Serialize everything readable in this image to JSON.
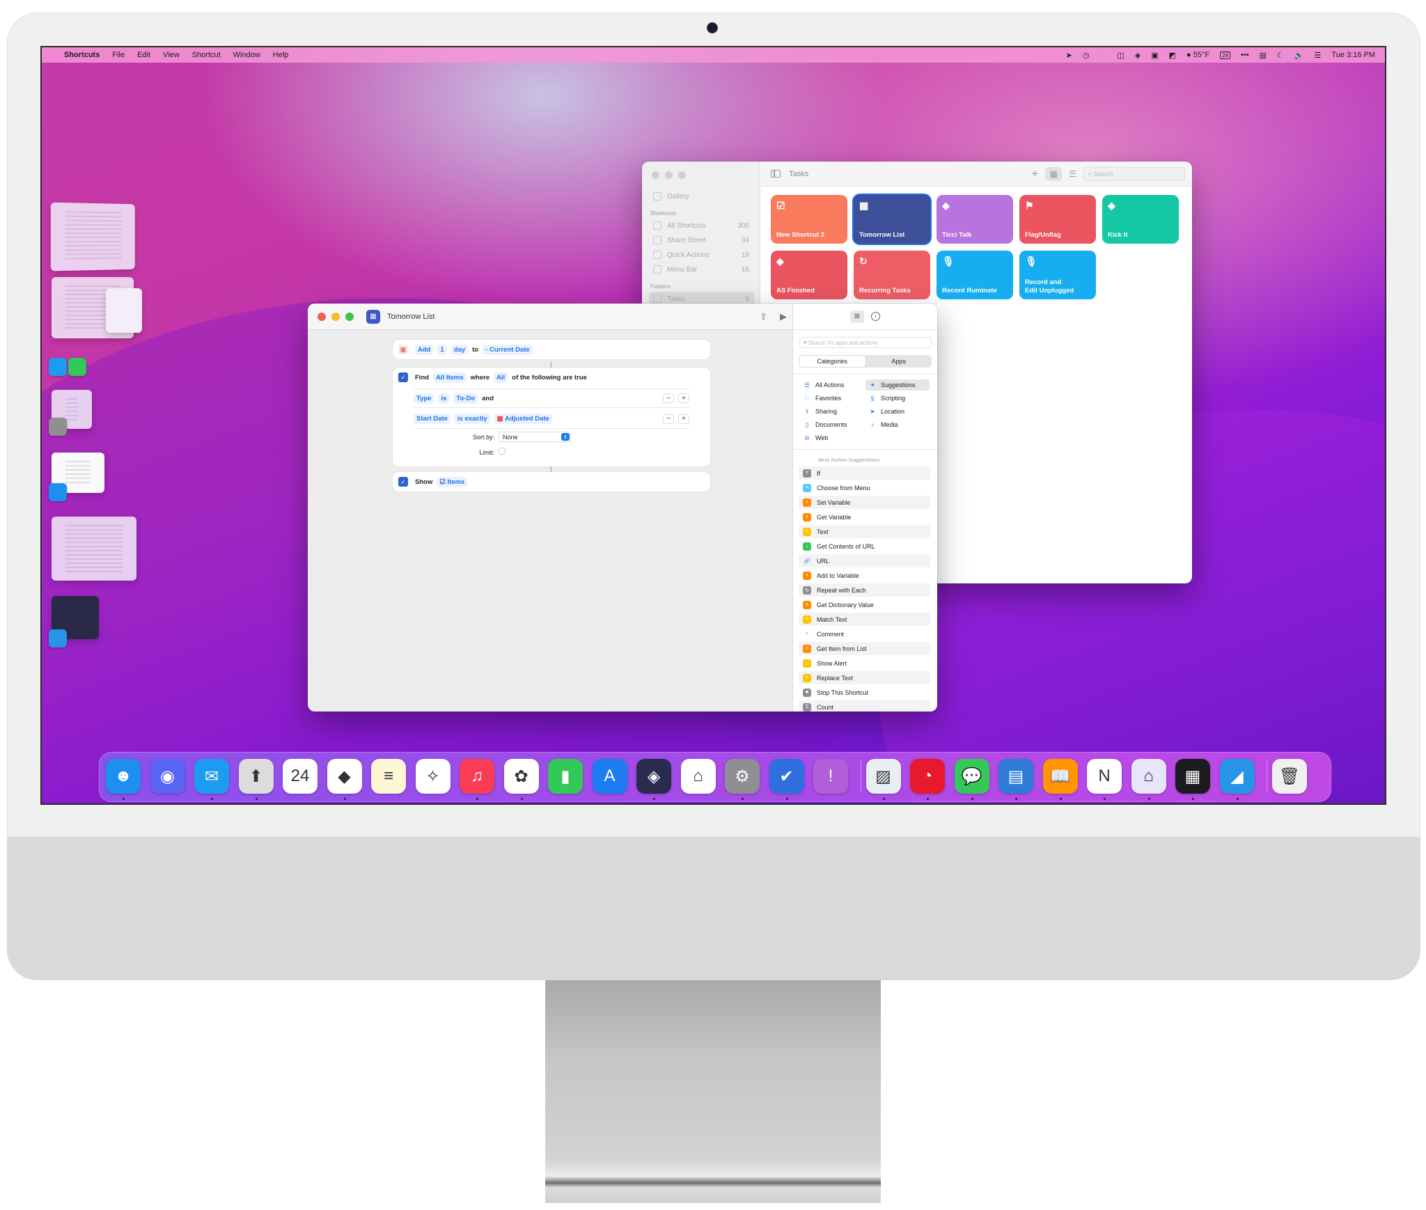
{
  "menubar": {
    "apple_icon": "apple-logo-icon",
    "app_name": "Shortcuts",
    "menus": [
      "File",
      "Edit",
      "View",
      "Shortcut",
      "Window",
      "Help"
    ],
    "status_icons": [
      "location-arrow-icon",
      "time-machine-icon",
      "focus-moon-icon",
      "split-view-icon",
      "layers-icon",
      "bookmark-icon",
      "cursor-pointer-icon",
      "weather-icon",
      "calendar-icon",
      "more-icon",
      "menu-app-icon",
      "moon-icon",
      "volume-icon",
      "control-center-icon"
    ],
    "weather": "55°F",
    "calendar_day": "24",
    "more": "•••",
    "clock": "Tue 3:16 PM"
  },
  "tasks_window": {
    "sidebar": {
      "gallery": "Gallery",
      "shortcuts_header": "Shortcuts",
      "items": [
        {
          "label": "All Shortcuts",
          "count": "300"
        },
        {
          "label": "Share Sheet",
          "count": "34"
        },
        {
          "label": "Quick Actions",
          "count": "18"
        },
        {
          "label": "Menu Bar",
          "count": "16"
        }
      ],
      "folders_header": "Folders",
      "folders": [
        {
          "label": "Tasks",
          "count": "9"
        }
      ]
    },
    "title": "Tasks",
    "add_label": "+",
    "search_placeholder": "Search",
    "tiles": [
      {
        "label": "New Shortcut 2",
        "icon": "☑",
        "color": "#f97a5c"
      },
      {
        "label": "Tomorrow List",
        "icon": "▦",
        "color": "#3e4f9a"
      },
      {
        "label": "Ticci Talk",
        "icon": "◈",
        "color": "#b873de"
      },
      {
        "label": "Flag/Unflag",
        "icon": "⚑",
        "color": "#ea5560"
      },
      {
        "label": "Kick It",
        "icon": "◈",
        "color": "#15c8a5"
      },
      {
        "label": "AS Finished",
        "icon": "◈",
        "color": "#ea5560"
      },
      {
        "label": "Recurring Tasks",
        "icon": "↻",
        "color": "#ef5d66"
      },
      {
        "label": "Record Ruminate",
        "icon": "🎙",
        "color": "#16aef0"
      },
      {
        "label": "Record  and\nEdit Unplugged",
        "icon": "🎙",
        "color": "#16aef0"
      }
    ]
  },
  "editor": {
    "title": "Tomorrow List",
    "actions": {
      "add": {
        "verb": "Add",
        "amount": "1",
        "unit": "day",
        "to": "to",
        "target": "Current Date"
      },
      "find": {
        "verb": "Find",
        "what": "All Items",
        "where": "where",
        "quantifier": "All",
        "suffix": "of the following are true",
        "conditions": [
          {
            "field": "Type",
            "op": "is",
            "value": "To-Do",
            "join": "and"
          },
          {
            "field": "Start Date",
            "op": "is exactly",
            "value": "Adjusted Date",
            "join": ""
          }
        ],
        "sort_label": "Sort by:",
        "sort_value": "None",
        "limit_label": "Limit:",
        "limit_checked": false
      },
      "show": {
        "verb": "Show",
        "target": "Items"
      }
    },
    "minus": "−",
    "plus": "+",
    "panel": {
      "search_placeholder": "Search for apps and actions",
      "segments": [
        "Categories",
        "Apps"
      ],
      "selected_segment": "Categories",
      "categories": [
        {
          "label": "All Actions",
          "icon": "☰"
        },
        {
          "label": "Favorites",
          "icon": "♡"
        },
        {
          "label": "Sharing",
          "icon": "⇪"
        },
        {
          "label": "Documents",
          "icon": "▯"
        },
        {
          "label": "Web",
          "icon": "⊘"
        },
        {
          "label": "Suggestions",
          "icon": "✦"
        },
        {
          "label": "Scripting",
          "icon": "§"
        },
        {
          "label": "Location",
          "icon": "➤"
        },
        {
          "label": "Media",
          "icon": "♪"
        }
      ],
      "suggestions_header": "Next Action Suggestions",
      "suggestions": [
        {
          "label": "If",
          "color": "#8e8e93",
          "glyph": "Y"
        },
        {
          "label": "Choose from Menu",
          "color": "#5ac8fa",
          "glyph": "≡"
        },
        {
          "label": "Set Variable",
          "color": "#ff8a00",
          "glyph": "x"
        },
        {
          "label": "Get Variable",
          "color": "#ff8a00",
          "glyph": "x"
        },
        {
          "label": "Text",
          "color": "#ffc400",
          "glyph": "≡"
        },
        {
          "label": "Get Contents of URL",
          "color": "#34c759",
          "glyph": "↓"
        },
        {
          "label": "URL",
          "color": "#e8effb",
          "glyph": "🔗"
        },
        {
          "label": "Add to Variable",
          "color": "#ff8a00",
          "glyph": "x"
        },
        {
          "label": "Repeat with Each",
          "color": "#8e8e93",
          "glyph": "↻"
        },
        {
          "label": "Get Dictionary Value",
          "color": "#ff8a00",
          "glyph": "o"
        },
        {
          "label": "Match Text",
          "color": "#ffc400",
          "glyph": "≡"
        },
        {
          "label": "Comment",
          "color": "#ffffff",
          "glyph": "≡"
        },
        {
          "label": "Get Item from List",
          "color": "#ff8a00",
          "glyph": "o"
        },
        {
          "label": "Show Alert",
          "color": "#ffc400",
          "glyph": "▭"
        },
        {
          "label": "Replace Text",
          "color": "#ffc400",
          "glyph": "≡"
        },
        {
          "label": "Stop This Shortcut",
          "color": "#8e8e93",
          "glyph": "■"
        },
        {
          "label": "Count",
          "color": "#8e8e93",
          "glyph": "Σ"
        }
      ]
    }
  },
  "dock": {
    "apps": [
      {
        "name": "Finder",
        "glyph": "☻",
        "color": "#1e8ef0",
        "running": true
      },
      {
        "name": "Discord",
        "glyph": "◉",
        "color": "#5865f2",
        "running": false
      },
      {
        "name": "Mail",
        "glyph": "✉",
        "color": "#1c9bf0",
        "running": true
      },
      {
        "name": "Archive Utility",
        "glyph": "⬆",
        "color": "#dcdcdc",
        "running": true
      },
      {
        "name": "Calendar",
        "glyph": "24",
        "color": "#ffffff",
        "running": false
      },
      {
        "name": "Obsidian",
        "glyph": "◆",
        "color": "#ffffff",
        "running": true
      },
      {
        "name": "Notes",
        "glyph": "≡",
        "color": "#fff6d6",
        "running": false
      },
      {
        "name": "Safari",
        "glyph": "✧",
        "color": "#ffffff",
        "running": false
      },
      {
        "name": "Music",
        "glyph": "♫",
        "color": "#fa3d55",
        "running": true
      },
      {
        "name": "Photos",
        "glyph": "✿",
        "color": "#ffffff",
        "running": true
      },
      {
        "name": "Numbers",
        "glyph": "▮",
        "color": "#34c759",
        "running": false
      },
      {
        "name": "App Store",
        "glyph": "A",
        "color": "#1e7cf2",
        "running": false
      },
      {
        "name": "Shortcuts",
        "glyph": "◈",
        "color": "#2b2b4f",
        "running": true
      },
      {
        "name": "Home",
        "glyph": "⌂",
        "color": "#ffffff",
        "running": false
      },
      {
        "name": "System Preferences",
        "glyph": "⚙",
        "color": "#8e8e93",
        "running": true
      },
      {
        "name": "Things",
        "glyph": "✔",
        "color": "#2f6fe0",
        "running": true
      },
      {
        "name": "Feedback Assistant",
        "glyph": "!",
        "color": "#b15fd8",
        "running": false
      },
      {
        "name": "Preview",
        "glyph": "▨",
        "color": "#e9eef5",
        "running": true
      },
      {
        "name": "Timery",
        "glyph": "◔",
        "color": "#e8192c",
        "running": true
      },
      {
        "name": "Messages",
        "glyph": "💬",
        "color": "#34c759",
        "running": true
      },
      {
        "name": "Pages",
        "glyph": "▤",
        "color": "#2f7cd7",
        "running": true
      },
      {
        "name": "Books",
        "glyph": "📖",
        "color": "#ff9500",
        "running": true
      },
      {
        "name": "Notion",
        "glyph": "N",
        "color": "#ffffff",
        "running": true
      },
      {
        "name": "GoodLinks",
        "glyph": "⌂",
        "color": "#e7e5f9",
        "running": true
      },
      {
        "name": "Button Creator",
        "glyph": "▦",
        "color": "#1c1c1e",
        "running": true
      },
      {
        "name": "CleanShot",
        "glyph": "◢",
        "color": "#2794e8",
        "running": true
      },
      {
        "name": "Trash",
        "glyph": "🗑",
        "color": "#f0f0f0",
        "running": false
      }
    ]
  },
  "stage_manager": {
    "groups": [
      "document-window-group",
      "mail-messages-group",
      "system-preferences-group",
      "finder-group",
      "web-browser-group",
      "cleanshot-group"
    ]
  }
}
